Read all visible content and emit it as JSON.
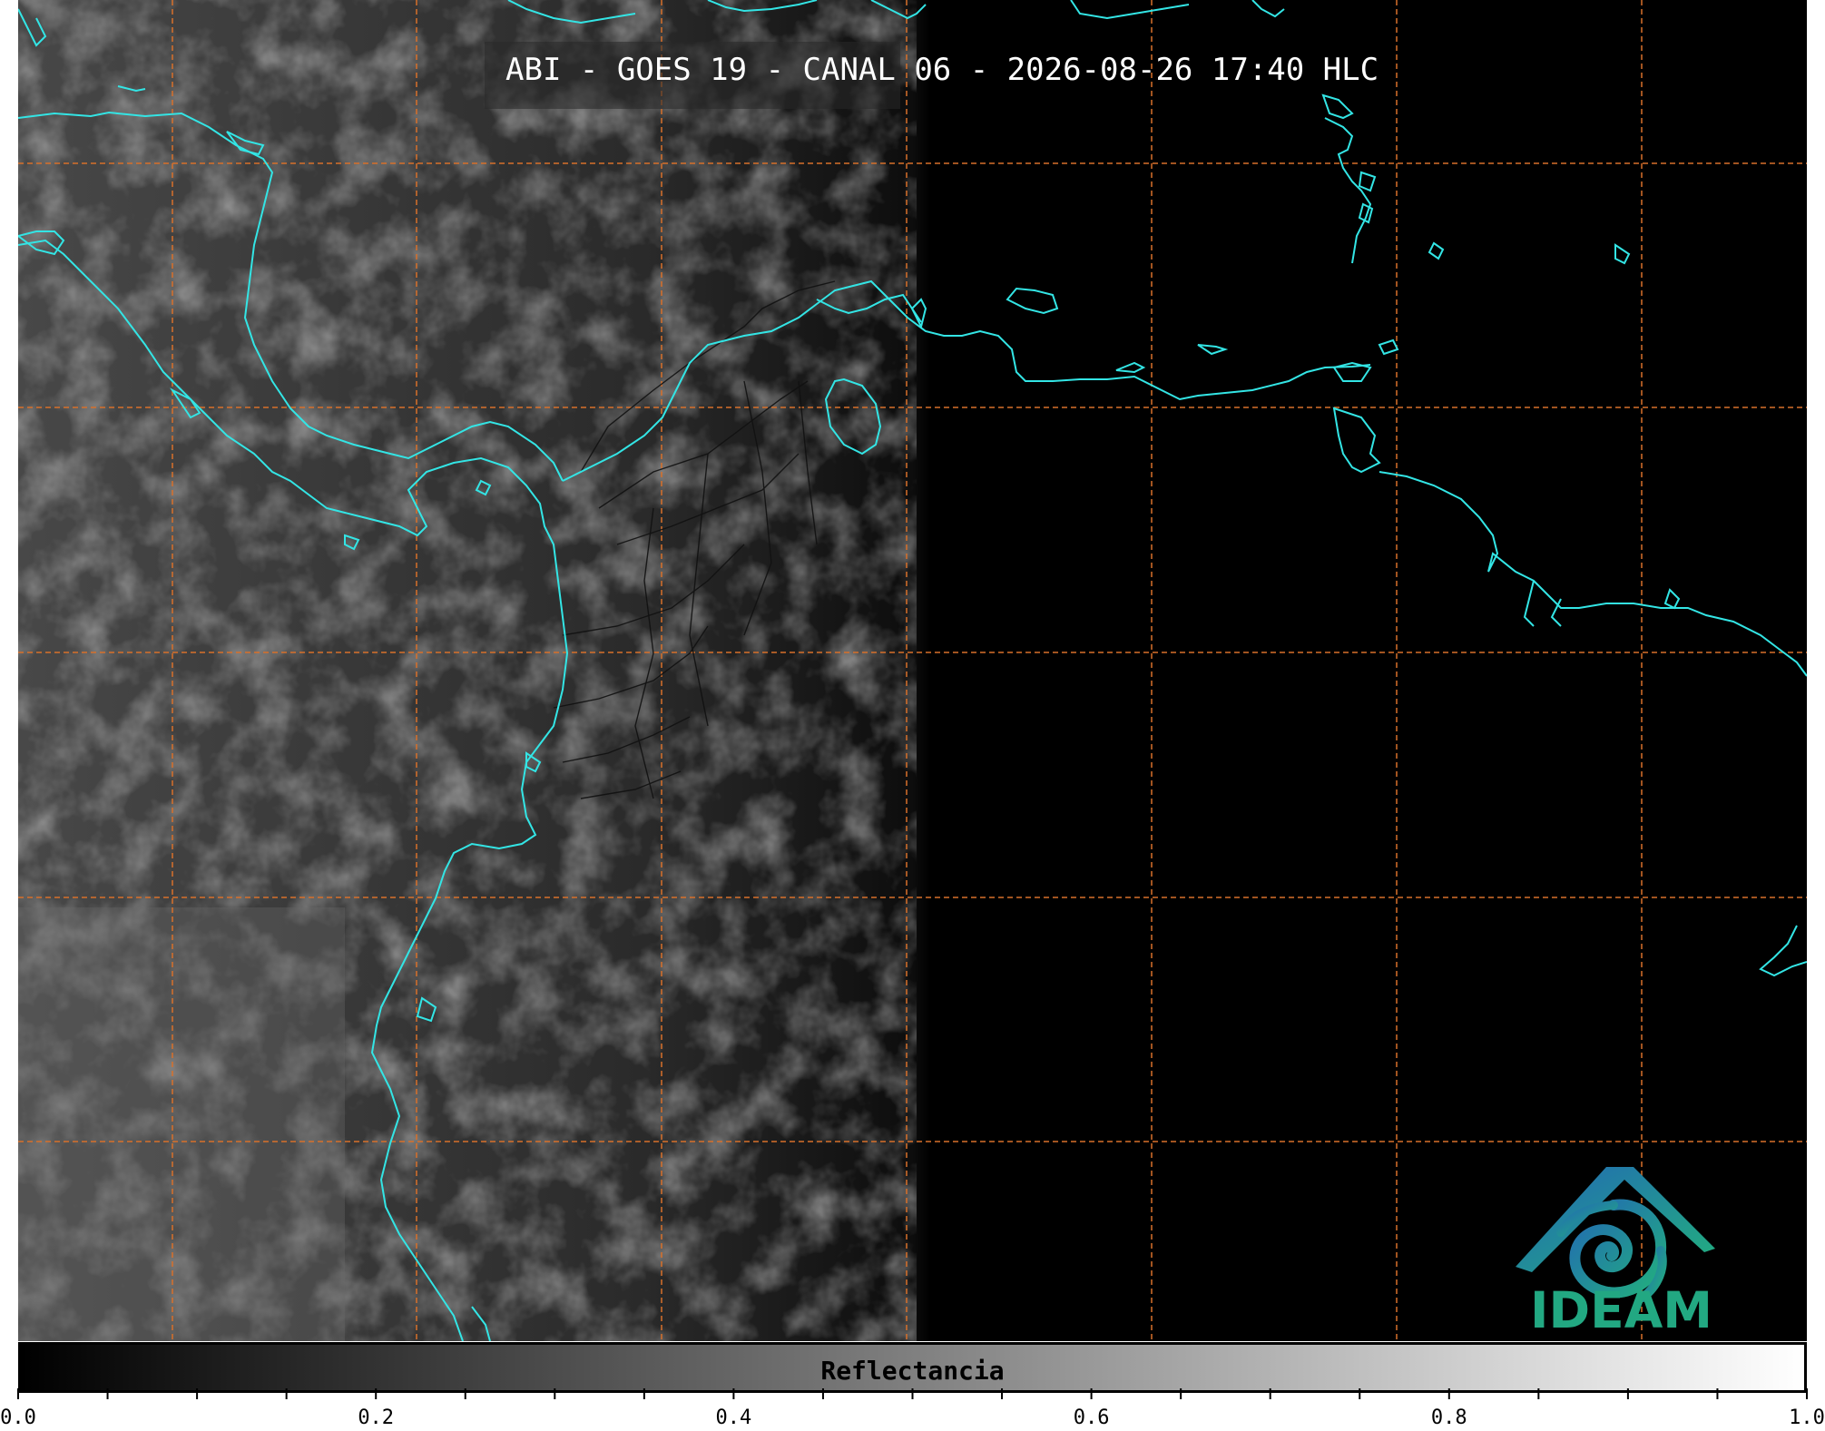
{
  "map": {
    "title": "ABI - GOES 19 - CANAL 06 - 2026-08-26 17:40 HLC",
    "coastline_color": "#33e5e5",
    "gridline_color": "#d8702a",
    "border_color": "#111111"
  },
  "logo": {
    "text": "IDEAM",
    "color": "#22a882",
    "accent_color": "#1f6fb0",
    "icon": "ideam-logo-icon"
  },
  "colorbar": {
    "label": "Reflectancia",
    "min": 0.0,
    "max": 1.0,
    "ticks": [
      {
        "value": 0.0,
        "label": "0.0"
      },
      {
        "value": 0.2,
        "label": "0.2"
      },
      {
        "value": 0.4,
        "label": "0.4"
      },
      {
        "value": 0.6,
        "label": "0.6"
      },
      {
        "value": 0.8,
        "label": "0.8"
      },
      {
        "value": 1.0,
        "label": "1.0"
      }
    ],
    "minor_step": 0.05,
    "colormap": [
      "#000000",
      "#ffffff"
    ]
  }
}
